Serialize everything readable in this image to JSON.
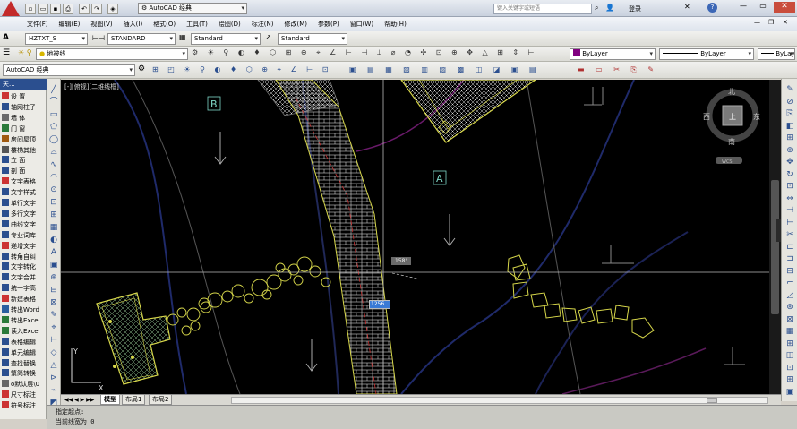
{
  "app": {
    "title": "AutoCAD 经典",
    "search_placeholder": "键入关键字或短语",
    "login": "登录"
  },
  "menus": [
    "文件(F)",
    "编辑(E)",
    "视图(V)",
    "插入(I)",
    "格式(O)",
    "工具(T)",
    "绘图(D)",
    "标注(N)",
    "修改(M)",
    "参数(P)",
    "窗口(W)",
    "帮助(H)"
  ],
  "toolbar1": {
    "text_style": "HZTXT_S",
    "dim_style": "STANDARD",
    "table_style": "Standard",
    "mleader_style": "Standard"
  },
  "toolbar2": {
    "layer": "地被线",
    "color": "ByLayer",
    "linetype": "ByLayer",
    "lineweight": "ByLayer"
  },
  "toolbar3": {
    "workspace": "AutoCAD 经典"
  },
  "left_palette": {
    "header": "天...",
    "items": [
      "设 置",
      "轴网柱子",
      "墙 体",
      "门 窗",
      "房间屋顶",
      "楼梯其他",
      "立 面",
      "剖 面",
      "文字表格",
      "文字样式",
      "单行文字",
      "多行文字",
      "曲线文字",
      "专业词库",
      "递增文字",
      "转角自纠",
      "文字转化",
      "文字合并",
      "统一字高",
      "新建表格",
      "转出Word",
      "转出Excel",
      "读入Excel",
      "表格编辑",
      "单元编辑",
      "查找替换",
      "繁简转换",
      "o默认层\\0",
      "尺寸标注",
      "符号标注"
    ]
  },
  "viewport": {
    "label": "[-][俯视][二维线框]",
    "compass": {
      "n": "北",
      "s": "南",
      "e": "东",
      "w": "西",
      "center": "上",
      "wcs": "WCS"
    },
    "marker_b": "B",
    "marker_a": "A",
    "angle_tooltip": "158°",
    "length_tooltip": "1256",
    "ucs_y": "Y",
    "ucs_x": "X"
  },
  "tabs": [
    "模型",
    "布局1",
    "布局2"
  ],
  "command": {
    "line1": "指定起点:",
    "line2": "当前线宽为 0"
  }
}
